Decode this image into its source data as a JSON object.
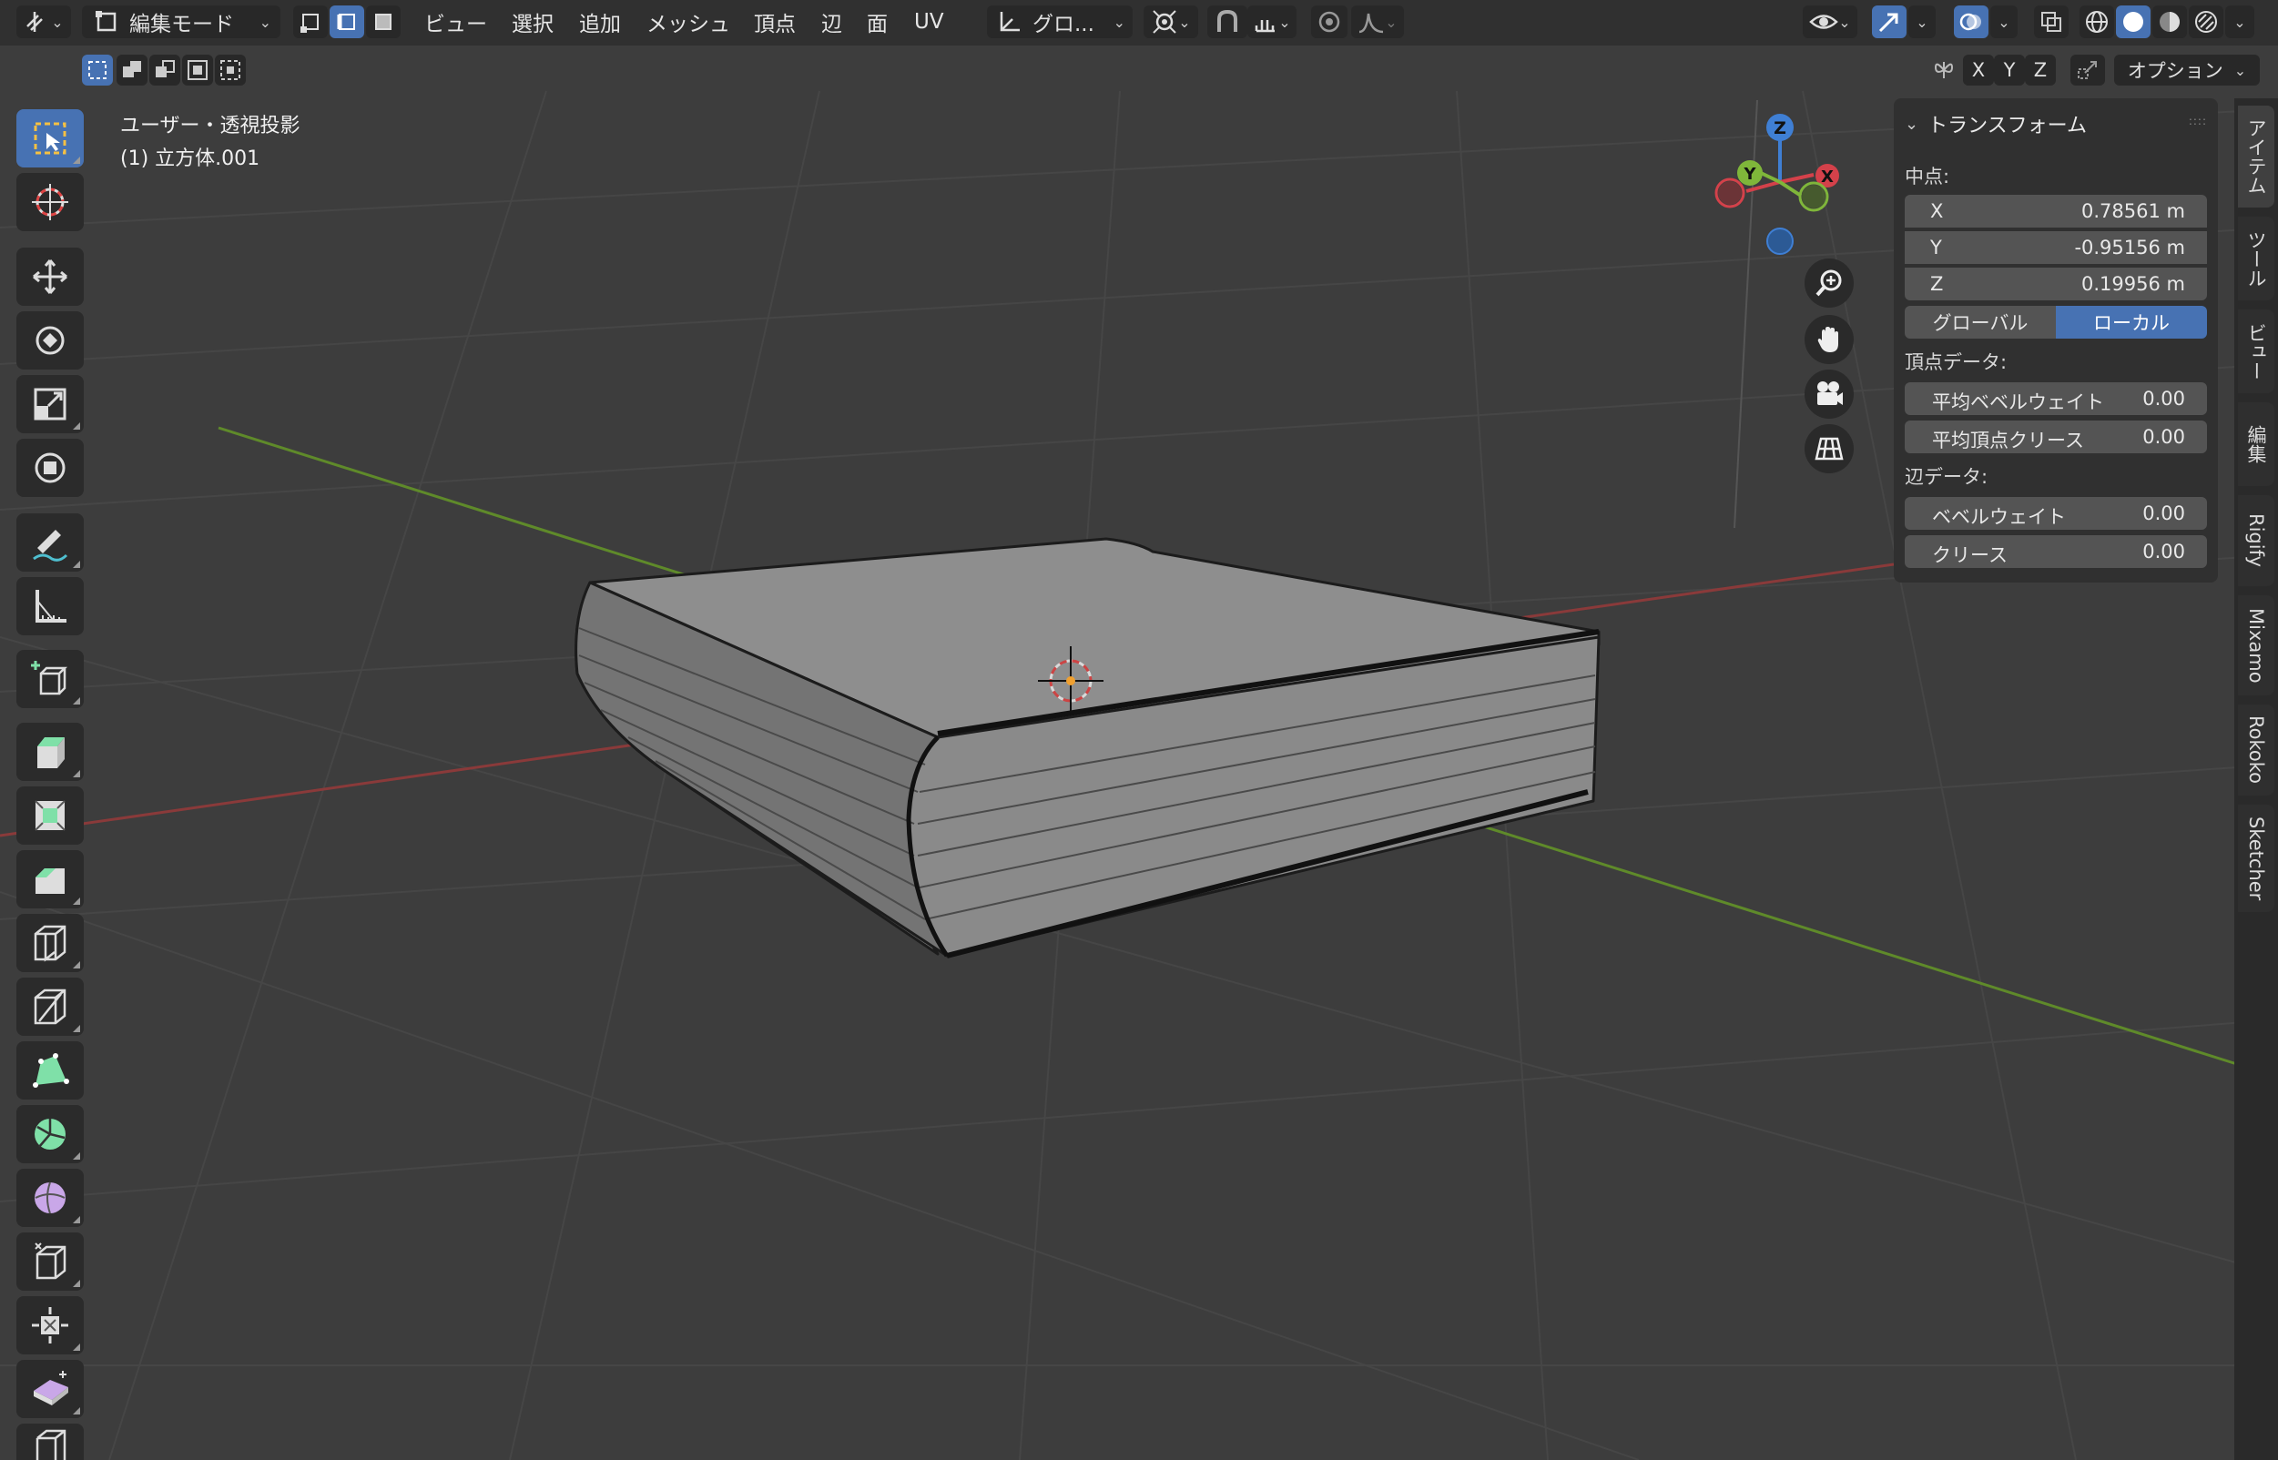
{
  "header": {
    "mode_label": "編集モード",
    "menus": [
      "ビュー",
      "選択",
      "追加",
      "メッシュ",
      "頂点",
      "辺",
      "面",
      "UV"
    ],
    "transform_orientation": "グロ...",
    "axis_x": "X",
    "axis_y": "Y",
    "axis_z": "Z",
    "options_label": "オプション"
  },
  "viewport": {
    "view_name": "ユーザー・透視投影",
    "object_name": "(1) 立方体.001",
    "gizmo": {
      "z": "Z",
      "y": "Y",
      "x": "X"
    }
  },
  "npanel": {
    "title": "トランスフォーム",
    "median_label": "中点:",
    "median": [
      {
        "axis": "X",
        "value": "0.78561 m"
      },
      {
        "axis": "Y",
        "value": "-0.95156 m"
      },
      {
        "axis": "Z",
        "value": "0.19956 m"
      }
    ],
    "space_global": "グローバル",
    "space_local": "ローカル",
    "vertex_data_label": "頂点データ:",
    "vertex_data": [
      {
        "label": "平均ベベルウェイト",
        "value": "0.00"
      },
      {
        "label": "平均頂点クリース",
        "value": "0.00"
      }
    ],
    "edge_data_label": "辺データ:",
    "edge_data": [
      {
        "label": "ベベルウェイト",
        "value": "0.00"
      },
      {
        "label": "クリース",
        "value": "0.00"
      }
    ]
  },
  "sidetabs": [
    "アイテム",
    "ツール",
    "ビュー",
    "編集",
    "Rigify",
    "Mixamo",
    "Rokoko",
    "Sketcher"
  ],
  "colors": {
    "accent": "#4772b3",
    "axis_x": "#d4414a",
    "axis_y": "#7fb63a",
    "axis_z": "#3f7fd4"
  }
}
